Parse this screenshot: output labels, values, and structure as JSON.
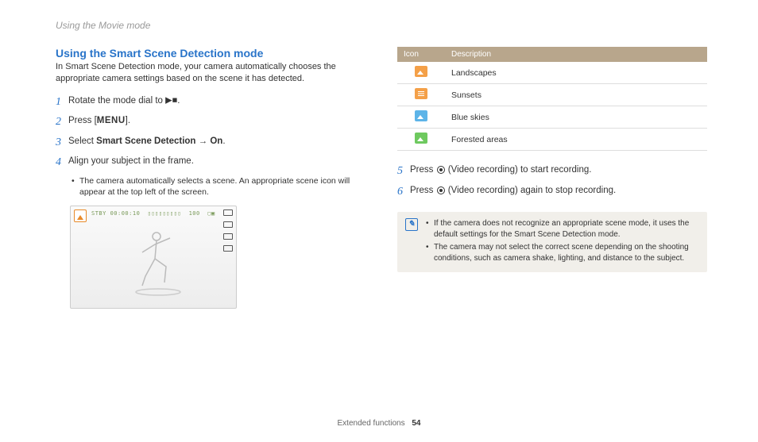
{
  "header": {
    "breadcrumb": "Using the Movie mode"
  },
  "section": {
    "title": "Using the Smart Scene Detection mode",
    "intro": "In Smart Scene Detection mode, your camera automatically chooses the appropriate camera settings based on the scene it has detected."
  },
  "steps": {
    "s1": {
      "num": "1",
      "prefix": "Rotate the mode dial to ",
      "suffix": "."
    },
    "s2": {
      "num": "2",
      "prefix": "Press [",
      "menu": "MENU",
      "suffix": "]."
    },
    "s3": {
      "num": "3",
      "prefix": "Select ",
      "bold1": "Smart Scene Detection",
      "arrow": " → ",
      "bold2": "On",
      "suffix": "."
    },
    "s4": {
      "num": "4",
      "text": "Align your subject in the frame.",
      "bullet": "The camera automatically selects a scene. An appropriate scene icon will appear at the top left of the screen."
    },
    "s5": {
      "num": "5",
      "pre": "Press ",
      "mid": " (Video recording) to start recording."
    },
    "s6": {
      "num": "6",
      "pre": "Press ",
      "mid": " (Video recording) again to stop recording."
    }
  },
  "screenshot": {
    "stby": "STBY 00:00:10",
    "value100": "100"
  },
  "table": {
    "h1": "Icon",
    "h2": "Description",
    "rows": [
      {
        "desc": "Landscapes",
        "cls": "orange"
      },
      {
        "desc": "Sunsets",
        "cls": "sunset"
      },
      {
        "desc": "Blue skies",
        "cls": "blue"
      },
      {
        "desc": "Forested areas",
        "cls": "green"
      }
    ]
  },
  "notes": {
    "n1": "If the camera does not recognize an appropriate scene mode, it uses the default settings for the Smart Scene Detection mode.",
    "n2": "The camera may not select the correct scene depending on the shooting conditions, such as camera shake, lighting, and distance to the subject."
  },
  "footer": {
    "label": "Extended functions",
    "page": "54"
  }
}
